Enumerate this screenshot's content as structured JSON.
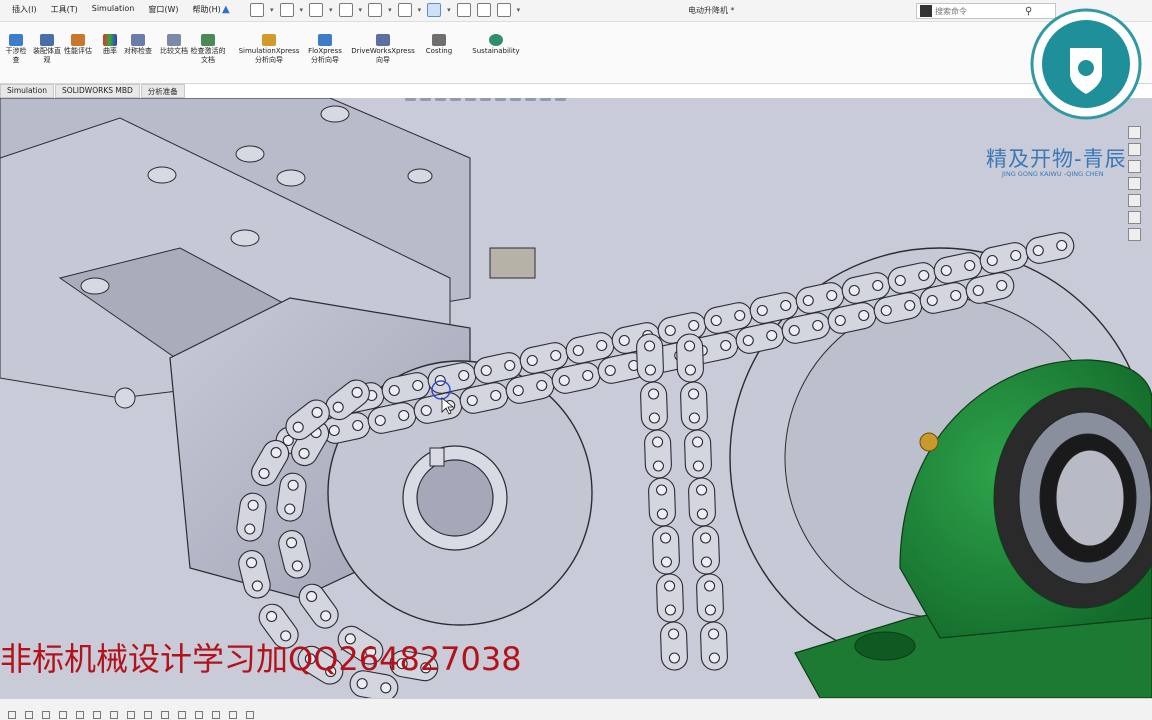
{
  "menu": {
    "items": [
      "插入(I)",
      "工具(T)",
      "Simulation",
      "窗口(W)",
      "帮助(H)"
    ]
  },
  "window": {
    "doc_title": "电动升降机 *"
  },
  "search": {
    "placeholder": "搜索命令"
  },
  "ribbon": {
    "buttons": [
      {
        "label": "干涉检查",
        "icon": "interference-icon"
      },
      {
        "label": "装配体直观",
        "icon": "assembly-visualization-icon"
      },
      {
        "label": "性能评估",
        "icon": "performance-icon"
      },
      {
        "label": "曲率",
        "icon": "curvature-icon"
      },
      {
        "label": "对称检查",
        "icon": "symmetry-icon"
      },
      {
        "label": "比较文档",
        "icon": "compare-icon"
      },
      {
        "label": "检查激活的文档",
        "icon": "check-document-icon"
      },
      {
        "label": "SimulationXpress 分析向导",
        "icon": "simulationxpress-icon"
      },
      {
        "label": "FloXpress 分析向导",
        "icon": "floxpress-icon"
      },
      {
        "label": "DriveWorksXpress 向导",
        "icon": "driveworksxpress-icon"
      },
      {
        "label": "Costing",
        "icon": "costing-icon"
      },
      {
        "label": "Sustainability",
        "icon": "sustainability-icon"
      }
    ]
  },
  "tabs": [
    "Simulation",
    "SOLIDWORKS MBD",
    "分析准备"
  ],
  "watermark": {
    "brand": "精及开物-青辰",
    "sub": "JING GONG KAIWU -QING CHEN"
  },
  "overlay_promo": "非标机械设计学习加QQ264827038",
  "colors": {
    "viewport_bg": "#c9ccd8",
    "part_gray": "#bfc2d0",
    "bearing_green": "#1f8a3a",
    "promo_red": "#b3121a",
    "accent_blue": "#2b6fd6"
  }
}
